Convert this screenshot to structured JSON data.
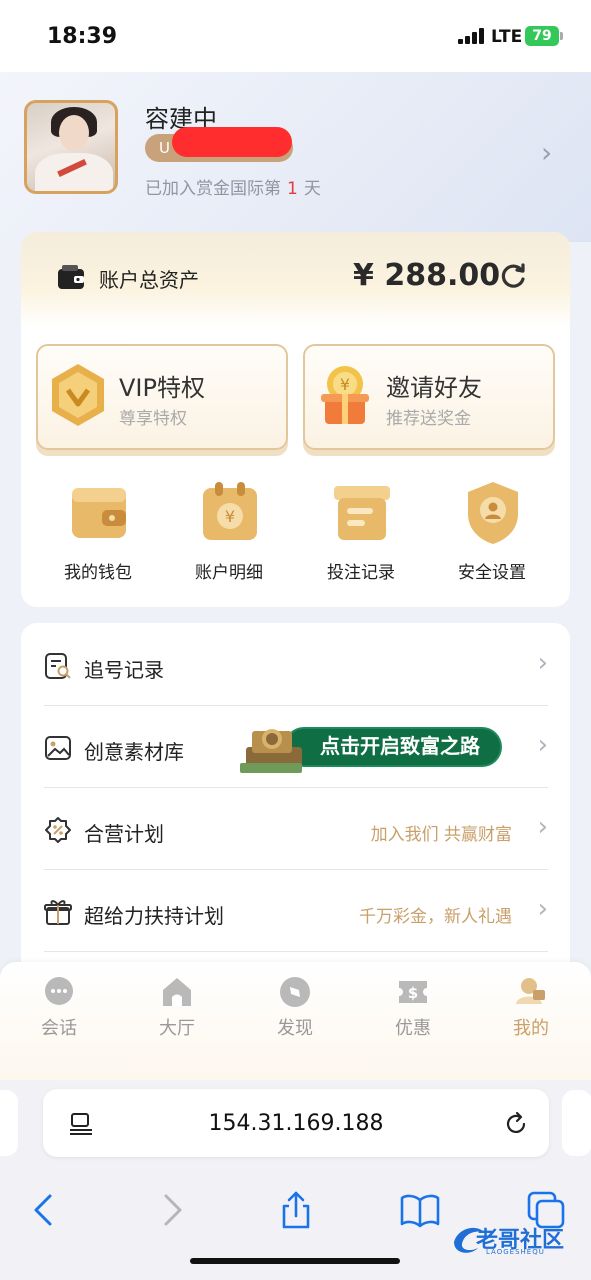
{
  "status_bar": {
    "time": "18:39",
    "network": "LTE",
    "battery": "79"
  },
  "profile": {
    "name": "容建中",
    "level_prefix": "U",
    "joined_prefix": "已加入赏金国际第",
    "joined_days": "1",
    "joined_suffix": "天"
  },
  "assets": {
    "label": "账户总资产",
    "value": "¥ 288.00"
  },
  "promos": [
    {
      "title": "VIP特权",
      "subtitle": "尊享特权"
    },
    {
      "title": "邀请好友",
      "subtitle": "推荐送奖金"
    }
  ],
  "quick_actions": [
    {
      "label": "我的钱包",
      "icon": "wallet-icon"
    },
    {
      "label": "账户明细",
      "icon": "ledger-icon"
    },
    {
      "label": "投注记录",
      "icon": "records-box-icon"
    },
    {
      "label": "安全设置",
      "icon": "shield-user-icon"
    }
  ],
  "menu": [
    {
      "label": "追号记录",
      "hint": "",
      "icon": "search-doc-icon"
    },
    {
      "label": "创意素材库",
      "hint": "",
      "icon": "image-icon",
      "banner_text": "点击开启致富之路"
    },
    {
      "label": "合营计划",
      "hint": "加入我们 共赢财富",
      "icon": "percent-badge-icon"
    },
    {
      "label": "超给力扶持计划",
      "hint": "千万彩金，新人礼遇",
      "icon": "gift-icon"
    }
  ],
  "tabs": [
    {
      "label": "会话",
      "icon": "chat-icon",
      "active": false
    },
    {
      "label": "大厅",
      "icon": "home-icon",
      "active": false
    },
    {
      "label": "发现",
      "icon": "compass-icon",
      "active": false
    },
    {
      "label": "优惠",
      "icon": "coupon-icon",
      "active": false
    },
    {
      "label": "我的",
      "icon": "profile-icon",
      "active": true
    }
  ],
  "browser": {
    "url": "154.31.169.188"
  },
  "watermark": {
    "text": "老哥社区",
    "subtext": "LAOGESHEQU"
  },
  "colors": {
    "accent_gold": "#c9a06a",
    "red": "#e23d3d",
    "text": "#222222"
  }
}
